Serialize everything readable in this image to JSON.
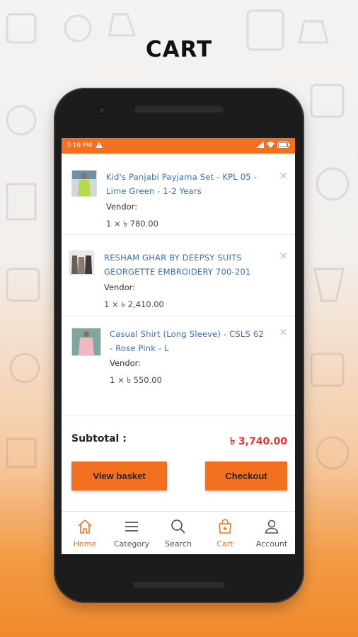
{
  "promo": {
    "title": "CART"
  },
  "statusbar": {
    "time": "3:16 PM"
  },
  "cart": {
    "items": [
      {
        "title": "Kid's Panjabi Payjama Set - KPL 05 - Lime Green - 1-2 Years",
        "title_line1": "Kid's Panjabi Payjama Set - KPL 05 -",
        "title_line2": "Lime Green - 1-2 Years",
        "vendor_label": "Vendor:",
        "qty_price": "1 × ৳ 780.00",
        "remove": "×"
      },
      {
        "title": "RESHAM GHAR BY DEEPSY SUITS GEORGETTE EMBROIDERY 700-201",
        "title_line1": "RESHAM GHAR BY DEEPSY SUITS",
        "title_line2": "GEORGETTE EMBROIDERY 700-201",
        "vendor_label": "Vendor:",
        "qty_price": "1 × ৳ 2,410.00",
        "remove": "×"
      },
      {
        "title": "Casual Shirt (Long Sleeve) - CSLS 62 - Rose Pink - L",
        "title_line1": "Casual Shirt (Long Sleeve) - CSLS 62",
        "title_line2": "- Rose Pink - L",
        "vendor_label": "Vendor:",
        "qty_price": "1 × ৳ 550.00",
        "remove": "×"
      }
    ]
  },
  "summary": {
    "subtotal_label": "Subtotal :",
    "subtotal_value": "৳ 3,740.00",
    "view_basket_label": "View basket",
    "checkout_label": "Checkout"
  },
  "tabs": [
    {
      "label": "Home",
      "icon": "home-icon",
      "active": true
    },
    {
      "label": "Category",
      "icon": "menu-icon",
      "active": false
    },
    {
      "label": "Search",
      "icon": "search-icon",
      "active": false
    },
    {
      "label": "Cart",
      "icon": "cart-icon",
      "active": true
    },
    {
      "label": "Account",
      "icon": "user-icon",
      "active": false
    }
  ],
  "colors": {
    "accent": "#f37021",
    "link": "#3a6fb5",
    "price_red": "#e8362a"
  }
}
